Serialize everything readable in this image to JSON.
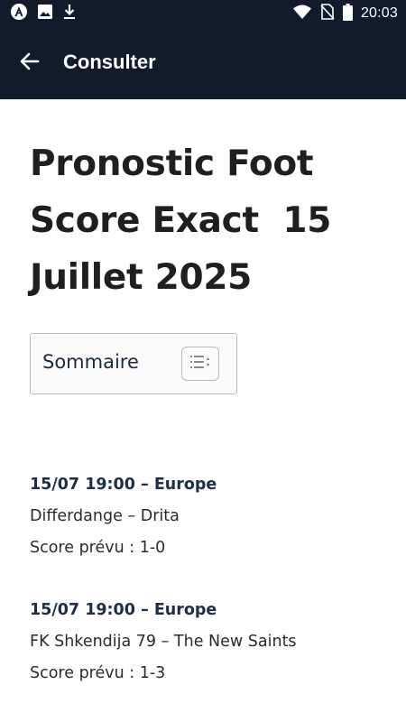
{
  "status_bar": {
    "time": "20:03",
    "icons_left": [
      "app-logo-icon",
      "image-icon",
      "download-icon"
    ],
    "icons_right": [
      "wifi-icon",
      "no-sim-icon",
      "battery-icon"
    ]
  },
  "app_bar": {
    "title": "Consulter",
    "back_icon": "arrow-left-icon"
  },
  "article": {
    "title_lines": [
      "Pronostic Foot",
      "Score Exact  15",
      "Juillet 2025"
    ]
  },
  "toc": {
    "label": "Sommaire",
    "toggle_icon": "list-toggle-icon"
  },
  "matches": [
    {
      "header": "15/07 19:00 – Europe",
      "teams": "Differdange – Drita",
      "score": "Score prévu : 1-0"
    },
    {
      "header": "15/07 19:00 – Europe",
      "teams": "FK Shkendija 79 – The New Saints",
      "score": "Score prévu : 1-3"
    }
  ],
  "colors": {
    "app_bar": "#121a2c",
    "match_header": "#1c2f4a",
    "title_text": "#1f1f1f"
  }
}
